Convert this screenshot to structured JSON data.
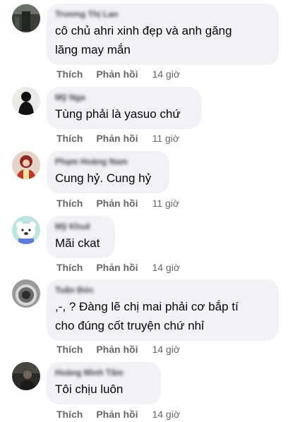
{
  "actions": {
    "like_label": "Thích",
    "reply_label": "Phản hồi"
  },
  "comments": [
    {
      "name": "Trương Thị Lan",
      "text": "cô chủ ahri xinh đẹp và anh găng lăng may mắn",
      "text_line1": "cô chủ ahri xinh đẹp và anh găng",
      "text_line2": "lăng may mắn",
      "time": "14 giờ",
      "avatar_icon": "user-avatar-dark"
    },
    {
      "name": "Mỹ Nga",
      "text": "Tùng phải là yasuo chứ",
      "time": "11 giờ",
      "avatar_icon": "user-avatar-silhouette"
    },
    {
      "name": "Phạm Hoàng Nam",
      "text": "Cung hỷ. Cung hỷ",
      "time": "11 giờ",
      "avatar_icon": "user-avatar-costume"
    },
    {
      "name": "Mỹ Khuê",
      "text": "Mãi ckat",
      "time": "14 giờ",
      "avatar_icon": "bear-avatar"
    },
    {
      "name": "Tuấn Đức",
      "text_line1": ",-, ? Đàng lẽ chị mai phải cơ bắp tí",
      "text_line2": "cho đúng cốt truyện chứ nhỉ",
      "time": "14 giờ",
      "avatar_icon": "user-avatar-grey"
    },
    {
      "name": "Hoàng Minh Tâm",
      "text": "Tôi chịu luôn",
      "time": "14 giờ",
      "avatar_icon": "user-avatar-night"
    }
  ]
}
